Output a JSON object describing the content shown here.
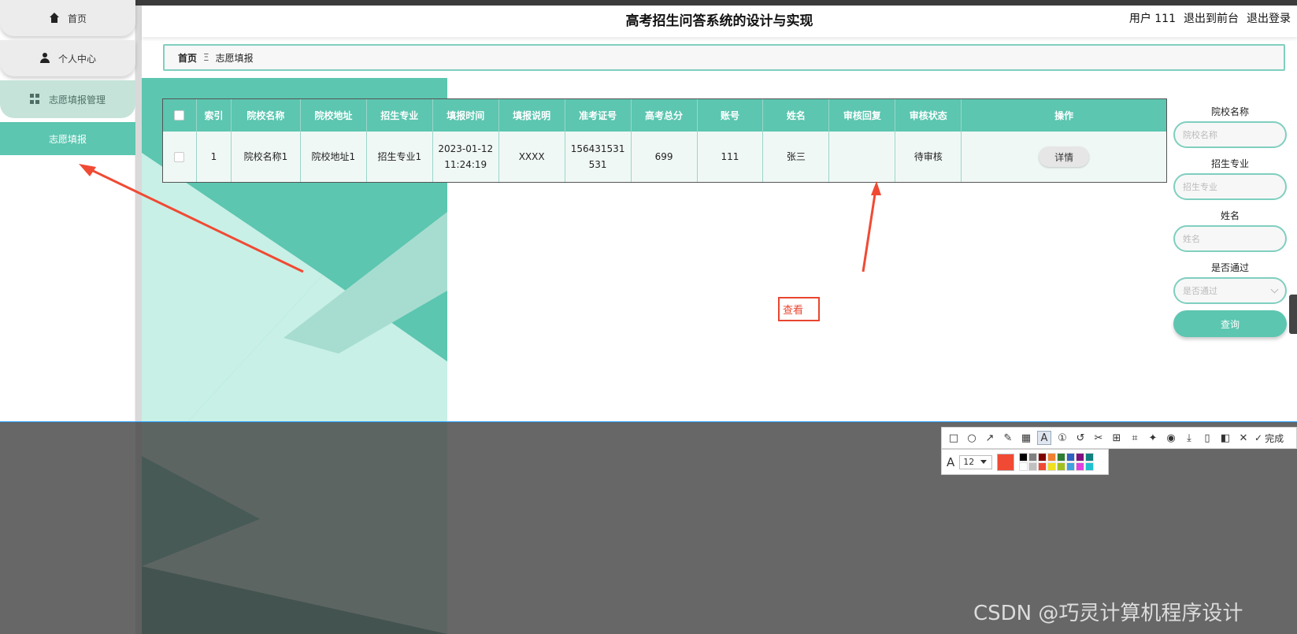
{
  "header": {
    "title": "高考招生问答系统的设计与实现",
    "user_label": "用户 111",
    "back_front": "退出到前台",
    "logout": "退出登录"
  },
  "sidebar": {
    "items": [
      {
        "label": "首页",
        "icon": "home-icon"
      },
      {
        "label": "个人中心",
        "icon": "user-icon"
      },
      {
        "label": "志愿填报管理",
        "icon": "grid-icon"
      },
      {
        "label": "志愿填报"
      }
    ]
  },
  "breadcrumb": {
    "home": "首页",
    "sep": "Ξ",
    "current": "志愿填报"
  },
  "table": {
    "columns": [
      "索引",
      "院校名称",
      "院校地址",
      "招生专业",
      "填报时间",
      "填报说明",
      "准考证号",
      "高考总分",
      "账号",
      "姓名",
      "审核回复",
      "审核状态",
      "操作"
    ],
    "rows": [
      {
        "index": "1",
        "school_name": "院校名称1",
        "school_address": "院校地址1",
        "major": "招生专业1",
        "fill_time": "2023-01-12 11:24:19",
        "fill_note": "XXXX",
        "exam_number": "156431531531",
        "total_score": "699",
        "account": "111",
        "name": "张三",
        "review_reply": "",
        "review_status": "待审核",
        "action": "详情"
      }
    ]
  },
  "search": {
    "school_label": "院校名称",
    "school_placeholder": "院校名称",
    "major_label": "招生专业",
    "major_placeholder": "招生专业",
    "name_label": "姓名",
    "name_placeholder": "姓名",
    "pass_label": "是否通过",
    "pass_placeholder": "是否通过",
    "query_button": "查询"
  },
  "annotation": {
    "text": "查看",
    "color": "#e8452f"
  },
  "screenshot_tool": {
    "font_size": "12",
    "done_label": "完成",
    "current_color": "#f04a34",
    "palette": [
      "#000000",
      "#808080",
      "#800000",
      "#f08030",
      "#2e7d32",
      "#3060c0",
      "#801080",
      "#108080",
      "#ffffff",
      "#c0c0c0",
      "#f04a34",
      "#f0e020",
      "#a0c020",
      "#40a0e0",
      "#e040e0",
      "#20c0d0"
    ]
  },
  "watermark": "CSDN @巧灵计算机程序设计",
  "colors": {
    "accent": "#5cc6b0",
    "accent_light": "#c5e3d9"
  }
}
